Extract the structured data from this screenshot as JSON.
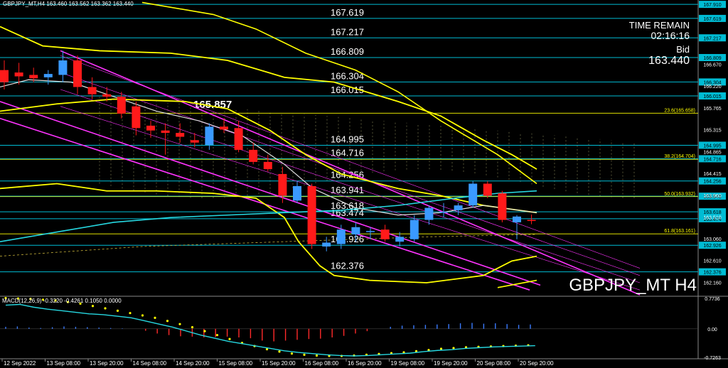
{
  "header": {
    "title_line": "GBPJPY_MT,H4  163.460 163.562 163.362 163.440"
  },
  "info": {
    "time_remain_label": "TIME REMAIN",
    "time_remain_value": "02:16:16",
    "bid_label": "Bid",
    "bid_value": "163.440",
    "symbol_watermark": "GBPJPY_MT H4"
  },
  "macd": {
    "label": "MACD(12,26,9) -0.3220 -0.4261 0.1050 0.0000",
    "scale": [
      "0.7736",
      "0.00",
      "-0.7263"
    ]
  },
  "chart_data": {
    "type": "candlestick",
    "symbol": "GBPJPY_MT",
    "timeframe": "H4",
    "ylim": [
      161.9,
      168.0
    ],
    "price_axis_ticks": [
      "166.670",
      "166.220",
      "165.765",
      "165.315",
      "164.865",
      "164.415",
      "163.960",
      "163.510",
      "163.060",
      "162.610",
      "162.160"
    ],
    "x_axis_labels": [
      "12 Sep 2022",
      "13 Sep 08:00",
      "13 Sep 20:00",
      "14 Sep 08:00",
      "14 Sep 20:00",
      "15 Sep 08:00",
      "15 Sep 20:00",
      "16 Sep 08:00",
      "16 Sep 20:00",
      "19 Sep 08:00",
      "19 Sep 20:00",
      "20 Sep 08:00",
      "20 Sep 20:00"
    ],
    "candles": [
      {
        "o": 166.55,
        "h": 166.75,
        "l": 166.15,
        "c": 166.3
      },
      {
        "o": 166.5,
        "h": 166.7,
        "l": 166.25,
        "c": 166.42
      },
      {
        "o": 166.45,
        "h": 166.6,
        "l": 166.3,
        "c": 166.38
      },
      {
        "o": 166.4,
        "h": 166.55,
        "l": 166.25,
        "c": 166.47
      },
      {
        "o": 166.45,
        "h": 166.95,
        "l": 166.3,
        "c": 166.75
      },
      {
        "o": 166.75,
        "h": 166.85,
        "l": 166.05,
        "c": 166.2
      },
      {
        "o": 166.2,
        "h": 166.4,
        "l": 165.95,
        "c": 166.05
      },
      {
        "o": 166.05,
        "h": 166.2,
        "l": 165.9,
        "c": 166.0
      },
      {
        "o": 166.0,
        "h": 166.1,
        "l": 165.55,
        "c": 165.65
      },
      {
        "o": 165.8,
        "h": 165.9,
        "l": 165.2,
        "c": 165.35
      },
      {
        "o": 165.4,
        "h": 165.5,
        "l": 165.15,
        "c": 165.3
      },
      {
        "o": 165.3,
        "h": 165.45,
        "l": 164.8,
        "c": 165.25
      },
      {
        "o": 165.25,
        "h": 165.45,
        "l": 165.05,
        "c": 165.17
      },
      {
        "o": 165.1,
        "h": 165.25,
        "l": 164.95,
        "c": 165.05
      },
      {
        "o": 165.0,
        "h": 165.45,
        "l": 164.9,
        "c": 165.38
      },
      {
        "o": 165.38,
        "h": 165.55,
        "l": 165.25,
        "c": 165.32
      },
      {
        "o": 165.35,
        "h": 165.5,
        "l": 164.85,
        "c": 164.9
      },
      {
        "o": 164.9,
        "h": 165.05,
        "l": 164.6,
        "c": 164.65
      },
      {
        "o": 164.65,
        "h": 164.8,
        "l": 164.45,
        "c": 164.5
      },
      {
        "o": 164.4,
        "h": 164.55,
        "l": 163.8,
        "c": 163.95
      },
      {
        "o": 163.85,
        "h": 164.25,
        "l": 163.8,
        "c": 164.15
      },
      {
        "o": 164.15,
        "h": 164.2,
        "l": 162.85,
        "c": 162.95
      },
      {
        "o": 162.9,
        "h": 163.1,
        "l": 162.8,
        "c": 162.98
      },
      {
        "o": 162.95,
        "h": 163.35,
        "l": 162.85,
        "c": 163.25
      },
      {
        "o": 163.15,
        "h": 163.4,
        "l": 163.0,
        "c": 163.3
      },
      {
        "o": 163.2,
        "h": 163.3,
        "l": 163.05,
        "c": 163.22
      },
      {
        "o": 163.25,
        "h": 163.35,
        "l": 163.0,
        "c": 163.05
      },
      {
        "o": 163.0,
        "h": 163.2,
        "l": 162.9,
        "c": 163.1
      },
      {
        "o": 163.05,
        "h": 163.55,
        "l": 163.0,
        "c": 163.45
      },
      {
        "o": 163.45,
        "h": 163.75,
        "l": 163.35,
        "c": 163.7
      },
      {
        "o": 163.6,
        "h": 163.8,
        "l": 163.5,
        "c": 163.62
      },
      {
        "o": 163.65,
        "h": 163.8,
        "l": 163.55,
        "c": 163.75
      },
      {
        "o": 163.75,
        "h": 164.25,
        "l": 163.7,
        "c": 164.2
      },
      {
        "o": 164.2,
        "h": 164.25,
        "l": 163.9,
        "c": 163.95
      },
      {
        "o": 164.0,
        "h": 164.05,
        "l": 163.4,
        "c": 163.45
      },
      {
        "o": 163.4,
        "h": 163.55,
        "l": 163.05,
        "c": 163.52
      },
      {
        "o": 163.45,
        "h": 163.56,
        "l": 163.36,
        "c": 163.44
      }
    ],
    "horizontal_levels": [
      {
        "price": 167.619,
        "label": "167.619",
        "axis_label": "167.619"
      },
      {
        "price": 167.217,
        "label": "167.217",
        "axis_label": "167.217"
      },
      {
        "price": 166.809,
        "label": "166.809",
        "axis_label": "166.809"
      },
      {
        "price": 166.304,
        "label": "166.304",
        "axis_label": "166.304"
      },
      {
        "price": 166.015,
        "label": "166.015",
        "axis_label": "166.015"
      },
      {
        "price": 164.995,
        "label": "164.995",
        "axis_label": "164.995"
      },
      {
        "price": 164.716,
        "label": "164.716",
        "axis_label": "164.716"
      },
      {
        "price": 164.256,
        "label": "164.256",
        "axis_label": "164.256"
      },
      {
        "price": 163.941,
        "label": "163.941",
        "axis_label": "163.941"
      },
      {
        "price": 163.618,
        "label": "163.618",
        "axis_label": "163.618"
      },
      {
        "price": 163.474,
        "label": "163.474",
        "axis_label": "163.474"
      },
      {
        "price": 162.926,
        "label": "162.926",
        "axis_label": "162.926"
      },
      {
        "price": 162.376,
        "label": "162.376",
        "axis_label": "162.376"
      }
    ],
    "top_level": {
      "price": 167.91,
      "axis_label": "167.910"
    },
    "fib_levels": [
      {
        "price": 165.658,
        "label": "23.6(165.658)"
      },
      {
        "price": 164.704,
        "label": "38.2(164.704)"
      },
      {
        "price": 163.932,
        "label": "50.0(163.932)"
      },
      {
        "price": 163.161,
        "label": "61.8(163.161)"
      }
    ],
    "highlight_label": {
      "price": 165.857,
      "text": "165.857"
    },
    "macd_hist": [
      0.05,
      0.06,
      0.03,
      0.02,
      0.04,
      0.06,
      0.05,
      0.04,
      0.03,
      0.02,
      0.01,
      0.0,
      -0.05,
      -0.12,
      -0.16,
      -0.19,
      -0.2,
      -0.22,
      -0.21,
      -0.2,
      -0.22,
      -0.24,
      -0.3,
      -0.32,
      -0.3,
      -0.28,
      -0.26,
      -0.25,
      -0.22,
      -0.18,
      -0.12,
      -0.06,
      0.0,
      0.05,
      0.08,
      0.09,
      0.1,
      0.11,
      0.12,
      0.14,
      0.15,
      0.13,
      0.14,
      0.12,
      0.1,
      0.11
    ],
    "macd_signal": [
      0.78,
      0.77,
      0.76,
      0.74,
      0.72,
      0.68,
      0.64,
      0.58,
      0.52,
      0.46,
      0.4,
      0.34,
      0.28,
      0.2,
      0.12,
      0.04,
      -0.06,
      -0.16,
      -0.26,
      -0.36,
      -0.44,
      -0.52,
      -0.58,
      -0.63,
      -0.66,
      -0.68,
      -0.69,
      -0.69,
      -0.68,
      -0.66,
      -0.64,
      -0.62,
      -0.6,
      -0.57,
      -0.54,
      -0.51,
      -0.49,
      -0.47,
      -0.46,
      -0.45,
      -0.44,
      -0.43,
      -0.42
    ],
    "macd_main": [
      0.6,
      0.62,
      0.55,
      0.5,
      0.46,
      0.42,
      0.38,
      0.36,
      0.32,
      0.28,
      0.2,
      0.12,
      0.04,
      -0.06,
      -0.16,
      -0.24,
      -0.32,
      -0.38,
      -0.44,
      -0.5,
      -0.56,
      -0.6,
      -0.63,
      -0.66,
      -0.68,
      -0.69,
      -0.68,
      -0.66,
      -0.64,
      -0.62,
      -0.58,
      -0.55,
      -0.53,
      -0.5,
      -0.48,
      -0.46,
      -0.45,
      -0.44,
      -0.43
    ],
    "colors": {
      "bull": "#3a9aff",
      "bear": "#ff1a1a",
      "hline": "#00bcd4",
      "level_text": "#ffffff",
      "fib": "#ffff00",
      "channel": "#ff33ff",
      "band": "#ffff00",
      "ma_cyan": "#26d7e0"
    }
  }
}
